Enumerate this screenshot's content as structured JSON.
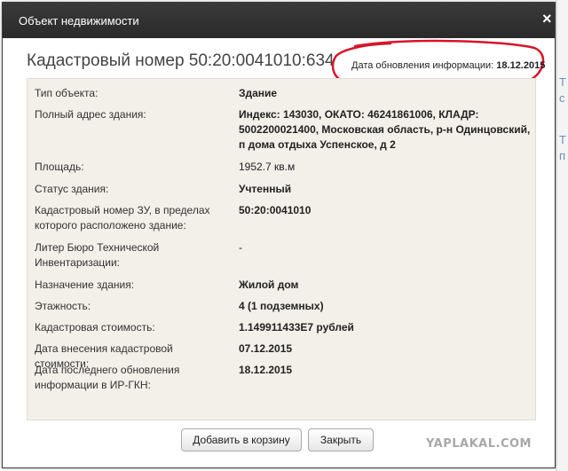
{
  "dialog": {
    "title": "Объект недвижимости",
    "close": "×",
    "heading": "Кадастровый номер 50:20:0041010:634",
    "update_label": "Дата обновления информации:",
    "update_value": "18.12.2015",
    "annotation_color": "#d7152a"
  },
  "rows": [
    {
      "label": "Тип объекта:",
      "value": "Здание"
    },
    {
      "label": "Полный адрес здания:",
      "value": "Индекс: 143030, ОКАТО: 46241861006, КЛАДР: 5002200021400, Московская область, р-н Одинцовский, п дома отдыха Успенское, д 2"
    },
    {
      "label": "Площадь:",
      "value": "1952.7 кв.м"
    },
    {
      "label": "Статус здания:",
      "value": "Учтенный"
    },
    {
      "label": "Кадастровый номер ЗУ, в пределах которого расположено здание:",
      "value": "50:20:0041010"
    },
    {
      "label": "Литер Бюро Технической Инвентаризации:",
      "value": "-"
    },
    {
      "label": "Назначение здания:",
      "value": "Жилой дом"
    },
    {
      "label": "Этажность:",
      "value": "4 (1 подземных)"
    },
    {
      "label": "Кадастровая стоимость:",
      "value": "1.149911433E7 рублей"
    },
    {
      "label": "Дата внесения кадастровой стоимости:",
      "value": "07.12.2015"
    },
    {
      "label": "Дата последнего обновления информации в ИР-ГКН:",
      "value": "18.12.2015"
    }
  ],
  "buttons": {
    "add_to_cart": "Добавить в корзину",
    "close": "Закрыть"
  },
  "background": {
    "letters": [
      "Т",
      "с",
      "Т",
      "п"
    ]
  },
  "watermark": "YAPLAKAL.COM"
}
